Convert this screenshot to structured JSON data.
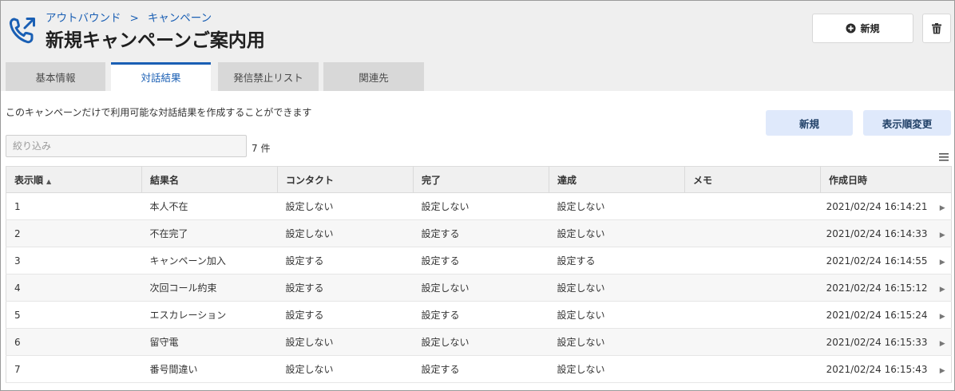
{
  "header": {
    "breadcrumb": [
      "アウトバウンド",
      "キャンペーン"
    ],
    "breadcrumb_sep": ">",
    "title": "新規キャンペーンご案内用",
    "new_button_label": "新規"
  },
  "tabs": [
    {
      "label": "基本情報",
      "active": false
    },
    {
      "label": "対話結果",
      "active": true
    },
    {
      "label": "発信禁止リスト",
      "active": false
    },
    {
      "label": "関連先",
      "active": false
    }
  ],
  "main": {
    "description": "このキャンペーンだけで利用可能な対話結果を作成することができます",
    "new_label": "新規",
    "reorder_label": "表示順変更",
    "filter_placeholder": "絞り込み",
    "count_text": "7 件"
  },
  "table": {
    "columns": [
      "表示順",
      "結果名",
      "コンタクト",
      "完了",
      "達成",
      "メモ",
      "作成日時"
    ],
    "sort_indicator": "▲",
    "rows": [
      {
        "order": "1",
        "name": "本人不在",
        "contact": "設定しない",
        "complete": "設定しない",
        "achieve": "設定しない",
        "memo": "",
        "created": "2021/02/24 16:14:21"
      },
      {
        "order": "2",
        "name": "不在完了",
        "contact": "設定しない",
        "complete": "設定する",
        "achieve": "設定しない",
        "memo": "",
        "created": "2021/02/24 16:14:33"
      },
      {
        "order": "3",
        "name": "キャンペーン加入",
        "contact": "設定する",
        "complete": "設定する",
        "achieve": "設定する",
        "memo": "",
        "created": "2021/02/24 16:14:55"
      },
      {
        "order": "4",
        "name": "次回コール約束",
        "contact": "設定する",
        "complete": "設定しない",
        "achieve": "設定しない",
        "memo": "",
        "created": "2021/02/24 16:15:12"
      },
      {
        "order": "5",
        "name": "エスカレーション",
        "contact": "設定する",
        "complete": "設定する",
        "achieve": "設定しない",
        "memo": "",
        "created": "2021/02/24 16:15:24"
      },
      {
        "order": "6",
        "name": "留守電",
        "contact": "設定しない",
        "complete": "設定しない",
        "achieve": "設定しない",
        "memo": "",
        "created": "2021/02/24 16:15:33"
      },
      {
        "order": "7",
        "name": "番号間違い",
        "contact": "設定しない",
        "complete": "設定する",
        "achieve": "設定しない",
        "memo": "",
        "created": "2021/02/24 16:15:43"
      }
    ]
  },
  "icons": {
    "header": "phone-outgoing-icon",
    "new": "plus-circle-icon",
    "delete": "trash-icon",
    "columns_menu": "hamburger-menu-icon",
    "row_expand": "caret-right-icon"
  },
  "colors": {
    "accent": "#1a5fb4",
    "header_bg": "#efefef",
    "tab_inactive": "#d8d8d8",
    "button_blue_bg": "#dfe9fb"
  }
}
